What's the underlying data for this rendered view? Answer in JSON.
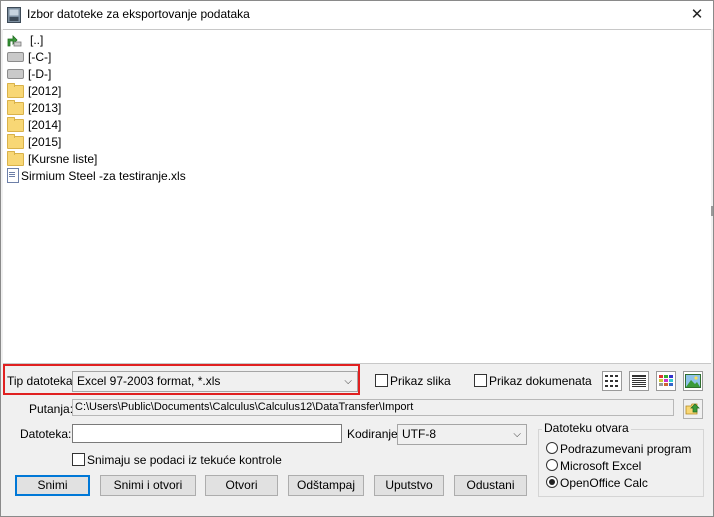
{
  "window": {
    "title": "Izbor datoteke za eksportovanje podataka"
  },
  "file_list": {
    "items": [
      {
        "label": "[..]",
        "icon": "up-folder-icon"
      },
      {
        "label": "[-C-]",
        "icon": "drive-icon"
      },
      {
        "label": "[-D-]",
        "icon": "drive-icon"
      },
      {
        "label": "[2012]",
        "icon": "folder-icon"
      },
      {
        "label": "[2013]",
        "icon": "folder-icon"
      },
      {
        "label": "[2014]",
        "icon": "folder-icon"
      },
      {
        "label": "[2015]",
        "icon": "folder-icon"
      },
      {
        "label": "[Kursne liste]",
        "icon": "folder-icon"
      },
      {
        "label": "Sirmium Steel -za testiranje.xls",
        "icon": "xls-file-icon"
      }
    ]
  },
  "file_type": {
    "label": "Tip datoteka:",
    "value": "Excel 97-2003 format, *.xls"
  },
  "show_images": {
    "label": "Prikaz slika",
    "checked": false
  },
  "show_documents": {
    "label": "Prikaz dokumenata",
    "checked": false
  },
  "path": {
    "label": "Putanja:",
    "value": "C:\\Users\\Public\\Documents\\Calculus\\Calculus12\\DataTransfer\\Import"
  },
  "filename": {
    "label": "Datoteka:",
    "value": ""
  },
  "encoding": {
    "label": "Kodiranje:",
    "value": "UTF-8"
  },
  "save_from_control": {
    "label": "Snimaju se podaci iz tekuće kontrole",
    "checked": false
  },
  "open_with": {
    "title": "Datoteku otvara",
    "options": [
      {
        "label": "Podrazumevani program",
        "selected": false
      },
      {
        "label": "Microsoft Excel",
        "selected": false
      },
      {
        "label": "OpenOffice Calc",
        "selected": true
      }
    ]
  },
  "buttons": {
    "save": "Snimi",
    "save_open": "Snimi i otvori",
    "open": "Otvori",
    "print": "Odštampaj",
    "help": "Uputstvo",
    "cancel": "Odustani"
  },
  "colors": {
    "highlight": "#e02020",
    "default_button_border": "#0078d7",
    "folder": "#f8d775"
  }
}
